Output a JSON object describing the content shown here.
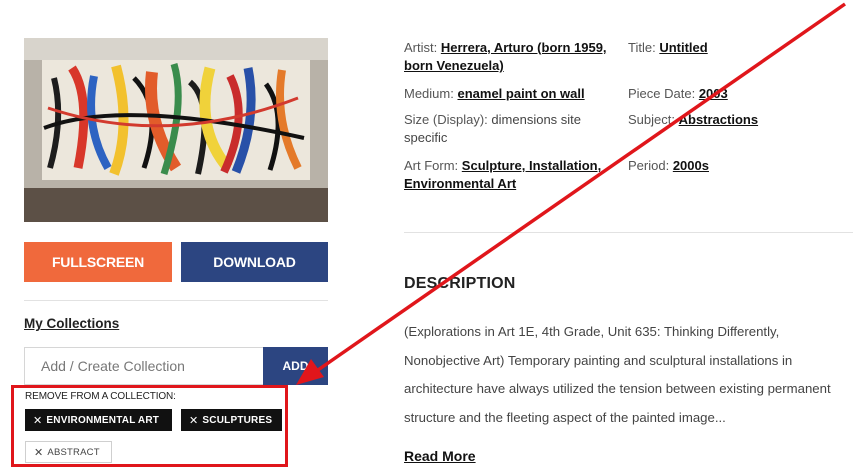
{
  "left_panel": {
    "fullscreen_label": "FULLSCREEN",
    "download_label": "DOWNLOAD",
    "my_collections_label": "My Collections",
    "collection_input_placeholder": "Add / Create Collection",
    "add_label": "ADD",
    "remove_label": "REMOVE FROM A COLLECTION:",
    "collection_tags": [
      {
        "label": "ENVIRONMENTAL ART",
        "style": "dark"
      },
      {
        "label": "SCULPTURES",
        "style": "dark"
      },
      {
        "label": "ABSTRACT",
        "style": "light"
      }
    ]
  },
  "metadata": {
    "artist_key": "Artist:",
    "artist_value": "Herrera, Arturo (born 1959, born Venezuela)",
    "title_key": "Title:",
    "title_value": "Untitled",
    "medium_key": "Medium:",
    "medium_value": "enamel paint on wall",
    "date_key": "Piece Date:",
    "date_value": "2003",
    "size_key": "Size (Display):",
    "size_value": "dimensions site specific",
    "subject_key": "Subject:",
    "subject_value": "Abstractions",
    "form_key": "Art Form:",
    "form_value": "Sculpture, Installation, Environmental Art",
    "period_key": "Period:",
    "period_value": "2000s"
  },
  "description": {
    "heading": "DESCRIPTION",
    "body": "(Explorations in Art 1E, 4th Grade, Unit 635: Thinking Differently, Nonobjective Art) Temporary painting and sculptural installations in architecture have always utilized the tension between existing permanent structure and the fleeting aspect of the painted image...",
    "read_more": "Read More"
  },
  "colors": {
    "orange": "#f0693c",
    "navy": "#2c4581",
    "annotation_red": "#e0161b"
  }
}
